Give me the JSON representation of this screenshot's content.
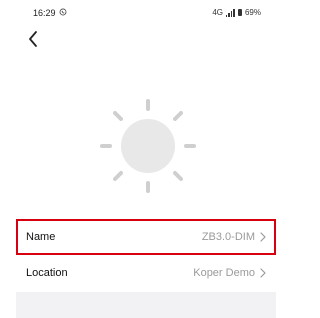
{
  "status_bar": {
    "time": "16:29",
    "network_text": "4G",
    "battery": "69%"
  },
  "device": {
    "name_label": "Name",
    "name_value": "ZB3.0-DIM",
    "location_label": "Location",
    "location_value": "Koper Demo"
  },
  "icons": {
    "back": "chevron-left-icon",
    "device": "sun-icon",
    "chevron": "chevron-right-icon"
  },
  "colors": {
    "highlight": "#d80010",
    "secondary_text": "#9a9a9a",
    "sun_fill": "#e7e7e7",
    "panel": "#f2f2f5"
  }
}
